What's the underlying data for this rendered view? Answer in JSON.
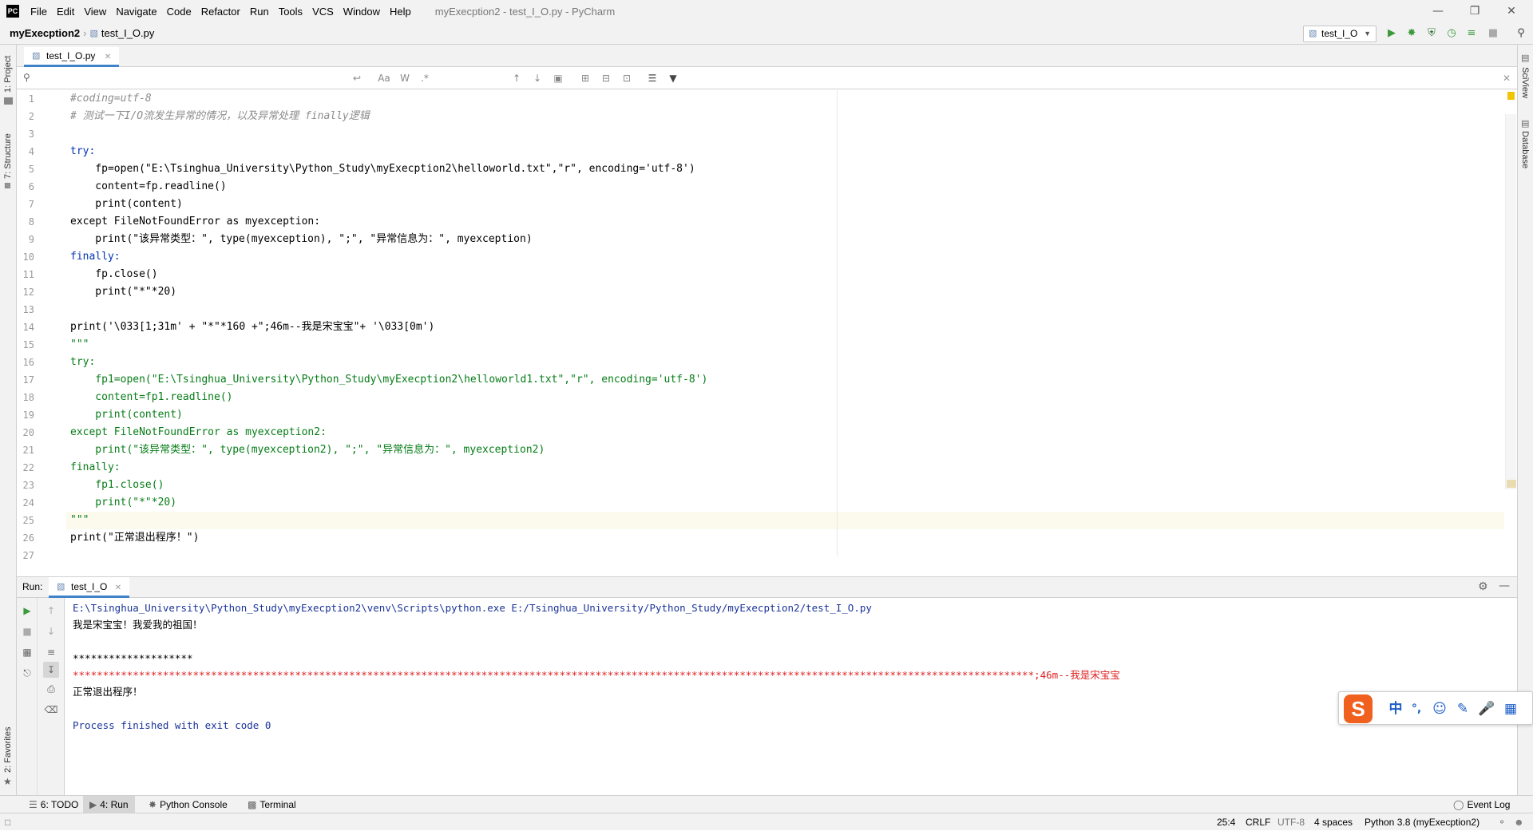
{
  "window": {
    "title": "myExecption2 - test_I_O.py - PyCharm",
    "menu": [
      "File",
      "Edit",
      "View",
      "Navigate",
      "Code",
      "Refactor",
      "Run",
      "Tools",
      "VCS",
      "Window",
      "Help"
    ]
  },
  "navbar": {
    "project": "myExecption2",
    "file": "test_I_O.py",
    "run_config": "test_I_O"
  },
  "editor": {
    "tab_label": "test_I_O.py",
    "find_placeholder": "",
    "find_options": {
      "match_case": "Aa",
      "words": "W",
      "regex": ".*"
    },
    "lines": [
      {
        "n": "1",
        "text": "#coding=utf-8",
        "color": "#8c8c8c",
        "italic": true
      },
      {
        "n": "2",
        "text": "# 测试一下I/O流发生异常的情况，以及异常处理 finally逻辑",
        "color": "#8c8c8c",
        "italic": true
      },
      {
        "n": "3",
        "text": "",
        "color": "#000"
      },
      {
        "n": "4",
        "text": "try:",
        "color": "#0033b3"
      },
      {
        "n": "5",
        "text": "    fp=open(\"E:\\Tsinghua_University\\Python_Study\\myExecption2\\helloworld.txt\",\"r\", encoding='utf-8')",
        "color": "#000"
      },
      {
        "n": "6",
        "text": "    content=fp.readline()",
        "color": "#000"
      },
      {
        "n": "7",
        "text": "    print(content)",
        "color": "#000"
      },
      {
        "n": "8",
        "text": "except FileNotFoundError as myexception:",
        "color": "#000"
      },
      {
        "n": "9",
        "text": "    print(\"该异常类型：\", type(myexception), \";\", \"异常信息为：\", myexception)",
        "color": "#000"
      },
      {
        "n": "10",
        "text": "finally:",
        "color": "#0033b3"
      },
      {
        "n": "11",
        "text": "    fp.close()",
        "color": "#000"
      },
      {
        "n": "12",
        "text": "    print(\"*\"*20)",
        "color": "#000"
      },
      {
        "n": "13",
        "text": "",
        "color": "#000"
      },
      {
        "n": "14",
        "text": "print('\\033[1;31m' + \"*\"*160 +\";46m--我是宋宝宝\"+ '\\033[0m')",
        "color": "#000"
      },
      {
        "n": "15",
        "text": "\"\"\"",
        "color": "#067d17"
      },
      {
        "n": "16",
        "text": "try:",
        "color": "#067d17"
      },
      {
        "n": "17",
        "text": "    fp1=open(\"E:\\Tsinghua_University\\Python_Study\\myExecption2\\helloworld1.txt\",\"r\", encoding='utf-8')",
        "color": "#067d17"
      },
      {
        "n": "18",
        "text": "    content=fp1.readline()",
        "color": "#067d17"
      },
      {
        "n": "19",
        "text": "    print(content)",
        "color": "#067d17"
      },
      {
        "n": "20",
        "text": "except FileNotFoundError as myexception2:",
        "color": "#067d17"
      },
      {
        "n": "21",
        "text": "    print(\"该异常类型：\", type(myexception2), \";\", \"异常信息为：\", myexception2)",
        "color": "#067d17"
      },
      {
        "n": "22",
        "text": "finally:",
        "color": "#067d17"
      },
      {
        "n": "23",
        "text": "    fp1.close()",
        "color": "#067d17"
      },
      {
        "n": "24",
        "text": "    print(\"*\"*20)",
        "color": "#067d17"
      },
      {
        "n": "25",
        "text": "\"\"\"",
        "color": "#067d17"
      },
      {
        "n": "26",
        "text": "print(\"正常退出程序！\")",
        "color": "#000"
      },
      {
        "n": "27",
        "text": "",
        "color": "#000"
      }
    ]
  },
  "run": {
    "label": "Run:",
    "tab": "test_I_O",
    "output": [
      {
        "text": "E:\\Tsinghua_University\\Python_Study\\myExecption2\\venv\\Scripts\\python.exe E:/Tsinghua_University/Python_Study/myExecption2/test_I_O.py",
        "color": "#1a3399"
      },
      {
        "text": "我是宋宝宝！我爱我的祖国！",
        "color": "#000"
      },
      {
        "text": "",
        "color": "#000"
      },
      {
        "text": "********************",
        "color": "#000"
      },
      {
        "text": "****************************************************************************************************************************************************************;46m--我是宋宝宝",
        "color": "#e02020"
      },
      {
        "text": "正常退出程序！",
        "color": "#000"
      },
      {
        "text": "",
        "color": "#000"
      },
      {
        "text": "Process finished with exit code 0",
        "color": "#1a3399"
      }
    ]
  },
  "side_tabs": {
    "project": "1: Project",
    "structure": "7: Structure",
    "favorites": "2: Favorites",
    "sciview": "SciView",
    "database": "Database"
  },
  "bottom_tabs": {
    "todo": "6: TODO",
    "run": "4: Run",
    "console": "Python Console",
    "terminal": "Terminal",
    "event_log": "Event Log"
  },
  "status": {
    "position": "25:4",
    "line_sep": "CRLF",
    "encoding": "UTF-8",
    "indent": "4 spaces",
    "interpreter": "Python 3.8 (myExecption2)"
  },
  "ime": {
    "lang": "中",
    "punct": "°,"
  }
}
